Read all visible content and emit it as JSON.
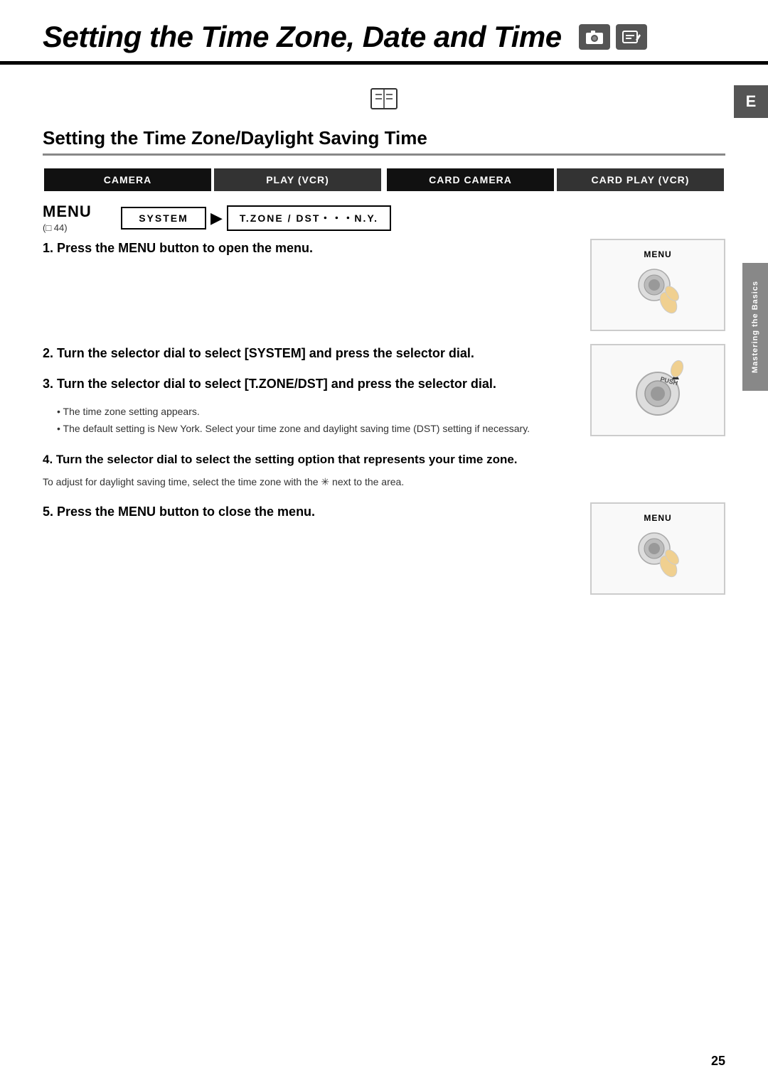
{
  "page": {
    "number": "25"
  },
  "title": {
    "text": "Setting the Time Zone, Date and Time",
    "icon1": "camera-icon",
    "icon2": "pen-icon"
  },
  "right_tab": {
    "label": "E"
  },
  "sidebar": {
    "label": "Mastering the Basics"
  },
  "book_ref": {
    "symbol": "□"
  },
  "section": {
    "heading": "Setting the Time Zone/Daylight Saving Time"
  },
  "mode_table": {
    "cells": [
      {
        "label": "CAMERA",
        "active": true
      },
      {
        "label": "PLAY (VCR)",
        "active": false
      },
      {
        "label": "CARD CAMERA",
        "active": true
      },
      {
        "label": "CARD PLAY (VCR)",
        "active": false
      }
    ]
  },
  "menu_row": {
    "menu_label": "MENU",
    "menu_ref": "(□ 44)",
    "system_label": "SYSTEM",
    "arrow": "▶",
    "tzone_label": "T.ZONE / DST・・・N.Y."
  },
  "steps": [
    {
      "number": "1",
      "text": "Press the MENU button to open the menu.",
      "image_label": "MENU",
      "has_image": true,
      "image_type": "button"
    },
    {
      "number": "2",
      "text": "Turn the selector dial to select [SYSTEM] and press the selector dial.",
      "has_image": true,
      "image_type": "dial"
    },
    {
      "number": "3",
      "text": "Turn the selector dial to select [T.ZONE/DST] and press the selector dial.",
      "has_image": false
    }
  ],
  "bullets": [
    "The time zone setting appears.",
    "The default setting is New York. Select your time zone and daylight saving time (DST) setting if necessary."
  ],
  "step4": {
    "text": "Turn the selector dial to select the setting option that represents your time zone.",
    "sub": "To adjust for daylight saving time, select the time zone with the ✳ next to the area."
  },
  "step5": {
    "text": "Press the MENU button to close the menu.",
    "image_label": "MENU",
    "has_image": true,
    "image_type": "button"
  }
}
